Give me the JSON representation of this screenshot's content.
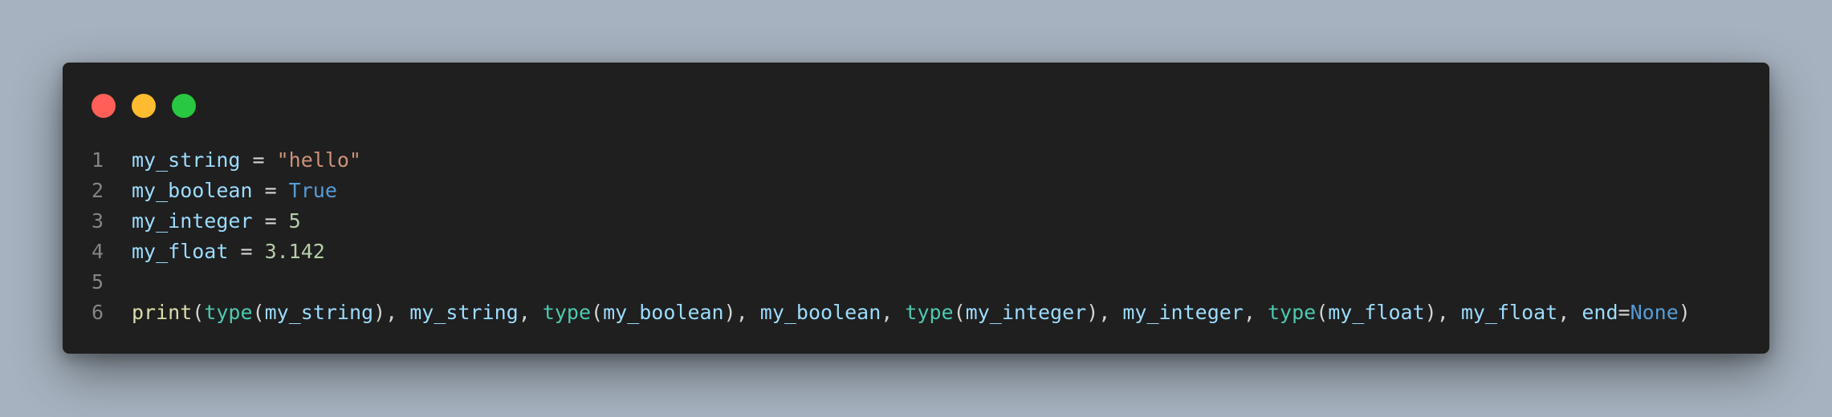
{
  "window": {
    "controls": [
      {
        "name": "close",
        "color": "#ff5f57"
      },
      {
        "name": "minimize",
        "color": "#febc2e"
      },
      {
        "name": "maximize",
        "color": "#28c840"
      }
    ]
  },
  "editor": {
    "lines": [
      {
        "number": "1",
        "tokens": [
          {
            "text": "my_string",
            "kind": "var"
          },
          {
            "text": " = ",
            "kind": "op"
          },
          {
            "text": "\"hello\"",
            "kind": "str"
          }
        ]
      },
      {
        "number": "2",
        "tokens": [
          {
            "text": "my_boolean",
            "kind": "var"
          },
          {
            "text": " = ",
            "kind": "op"
          },
          {
            "text": "True",
            "kind": "kw"
          }
        ]
      },
      {
        "number": "3",
        "tokens": [
          {
            "text": "my_integer",
            "kind": "var"
          },
          {
            "text": " = ",
            "kind": "op"
          },
          {
            "text": "5",
            "kind": "num"
          }
        ]
      },
      {
        "number": "4",
        "tokens": [
          {
            "text": "my_float",
            "kind": "var"
          },
          {
            "text": " = ",
            "kind": "op"
          },
          {
            "text": "3.142",
            "kind": "num"
          }
        ]
      },
      {
        "number": "5",
        "tokens": []
      },
      {
        "number": "6",
        "tokens": [
          {
            "text": "print",
            "kind": "fn"
          },
          {
            "text": "(",
            "kind": "punc"
          },
          {
            "text": "type",
            "kind": "type"
          },
          {
            "text": "(",
            "kind": "punc"
          },
          {
            "text": "my_string",
            "kind": "var"
          },
          {
            "text": "), ",
            "kind": "punc"
          },
          {
            "text": "my_string",
            "kind": "var"
          },
          {
            "text": ", ",
            "kind": "punc"
          },
          {
            "text": "type",
            "kind": "type"
          },
          {
            "text": "(",
            "kind": "punc"
          },
          {
            "text": "my_boolean",
            "kind": "var"
          },
          {
            "text": "), ",
            "kind": "punc"
          },
          {
            "text": "my_boolean",
            "kind": "var"
          },
          {
            "text": ", ",
            "kind": "punc"
          },
          {
            "text": "type",
            "kind": "type"
          },
          {
            "text": "(",
            "kind": "punc"
          },
          {
            "text": "my_integer",
            "kind": "var"
          },
          {
            "text": "), ",
            "kind": "punc"
          },
          {
            "text": "my_integer",
            "kind": "var"
          },
          {
            "text": ", ",
            "kind": "punc"
          },
          {
            "text": "type",
            "kind": "type"
          },
          {
            "text": "(",
            "kind": "punc"
          },
          {
            "text": "my_float",
            "kind": "var"
          },
          {
            "text": "), ",
            "kind": "punc"
          },
          {
            "text": "my_float",
            "kind": "var"
          },
          {
            "text": ", ",
            "kind": "punc"
          },
          {
            "text": "end",
            "kind": "var"
          },
          {
            "text": "=",
            "kind": "op"
          },
          {
            "text": "None",
            "kind": "kw"
          },
          {
            "text": ")",
            "kind": "punc"
          }
        ]
      }
    ]
  }
}
